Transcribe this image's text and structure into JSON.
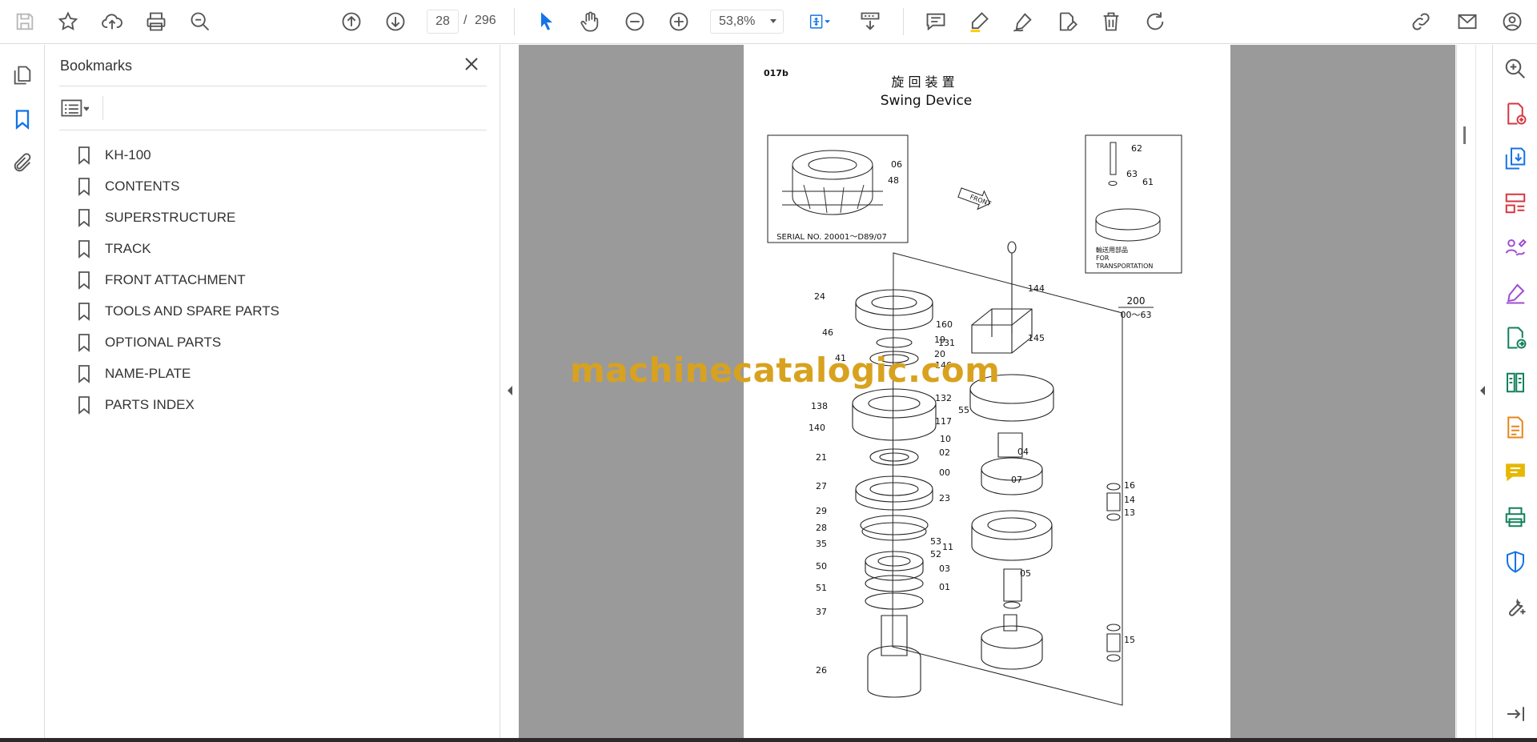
{
  "toolbar": {
    "page_current": "28",
    "page_separator": "/",
    "page_total": "296",
    "zoom": "53,8%"
  },
  "bookmarks": {
    "title": "Bookmarks",
    "items": [
      {
        "label": "KH-100"
      },
      {
        "label": "CONTENTS"
      },
      {
        "label": "SUPERSTRUCTURE"
      },
      {
        "label": "TRACK"
      },
      {
        "label": "FRONT ATTACHMENT"
      },
      {
        "label": "TOOLS AND SPARE PARTS"
      },
      {
        "label": "OPTIONAL PARTS"
      },
      {
        "label": "NAME-PLATE"
      },
      {
        "label": "PARTS INDEX"
      }
    ]
  },
  "document": {
    "page_code": "017b",
    "title_jp": "旋 回 装 置",
    "title_en": "Swing Device",
    "serial_note": "SERIAL NO. 20001～D89/07",
    "transport_note_jp": "輸送用部品",
    "transport_note_en_1": "FOR",
    "transport_note_en_2": "TRANSPORTATION",
    "front_label": "FRONT",
    "group_code_top": "200",
    "group_code_bottom": "00～63",
    "watermark": "machinecatalogic.com",
    "part_numbers": [
      "06",
      "48",
      "62",
      "63",
      "61",
      "24",
      "46",
      "41",
      "19",
      "20",
      "55",
      "138",
      "140",
      "21",
      "27",
      "29",
      "28",
      "35",
      "50",
      "51",
      "37",
      "26",
      "53",
      "52",
      "144",
      "160",
      "131",
      "145",
      "146",
      "132",
      "117",
      "10",
      "02",
      "00",
      "04",
      "07",
      "16",
      "14",
      "13",
      "23",
      "11",
      "03",
      "05",
      "01",
      "15"
    ]
  },
  "colors": {
    "accent": "#1473e6",
    "watermark": "#d8a21f",
    "doc_background": "#9a9a9a"
  }
}
